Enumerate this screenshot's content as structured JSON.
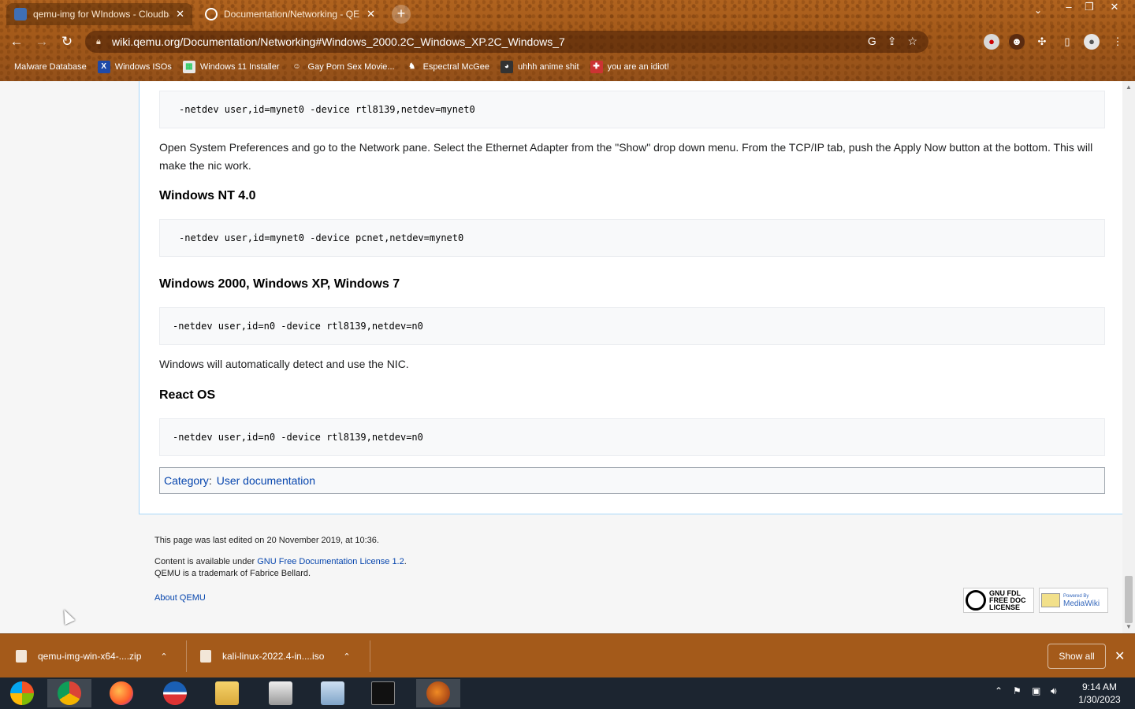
{
  "browser": {
    "tabs": [
      {
        "title": "qemu-img for WIndows - Cloudbase",
        "active": true
      },
      {
        "title": "Documentation/Networking - QEMU",
        "active": false
      }
    ],
    "url": "wiki.qemu.org/Documentation/Networking#Windows_2000.2C_Windows_XP.2C_Windows_7",
    "bookmarks": [
      {
        "label": "Malware Database",
        "icon": "skull-icon"
      },
      {
        "label": "Windows ISOs",
        "icon": "x-icon"
      },
      {
        "label": "Windows 11 Installer",
        "icon": "installer-icon"
      },
      {
        "label": "Gay Porn Sex Movie...",
        "icon": "face-icon"
      },
      {
        "label": "Espectral McGee",
        "icon": "ghost-icon"
      },
      {
        "label": "uhhh anime shit",
        "icon": "anime-icon"
      },
      {
        "label": "you are an idiot!",
        "icon": "flag-icon"
      }
    ]
  },
  "page": {
    "code1": "-netdev user,id=mynet0 -device rtl8139,netdev=mynet0",
    "para1": "Open System Preferences and go to the Network pane. Select the Ethernet Adapter from the \"Show\" drop down menu. From the TCP/IP tab, push the Apply Now button at the bottom. This will make the nic work.",
    "heading_nt": "Windows NT 4.0",
    "code_nt": "-netdev user,id=mynet0 -device pcnet,netdev=mynet0",
    "heading_win": "Windows 2000, Windows XP, Windows 7",
    "code_win": "-netdev user,id=n0 -device rtl8139,netdev=n0",
    "para_win": "Windows will automatically detect and use the NIC.",
    "heading_react": "React OS",
    "code_react": "-netdev user,id=n0 -device rtl8139,netdev=n0",
    "category_label": "Category",
    "category_colon": ":",
    "category_link": "User documentation"
  },
  "footer": {
    "last_edited": "This page was last edited on 20 November 2019, at 10:36.",
    "content_prefix": "Content is available under ",
    "license_link": "GNU Free Documentation License 1.2",
    "content_suffix": ".",
    "trademark": "QEMU is a trademark of Fabrice Bellard.",
    "about_link": "About QEMU",
    "badge_gfdl_line1": "GNU FDL",
    "badge_gfdl_line2": "FREE DOC",
    "badge_gfdl_line3": "LICENSE",
    "badge_mw_line1": "Powered By",
    "badge_mw_line2": "MediaWiki"
  },
  "downloads": {
    "items": [
      {
        "name": "qemu-img-win-x64-....zip"
      },
      {
        "name": "kali-linux-2022.4-in....iso"
      }
    ],
    "show_all": "Show all"
  },
  "taskbar": {
    "time": "9:14 AM",
    "date": "1/30/2023"
  }
}
